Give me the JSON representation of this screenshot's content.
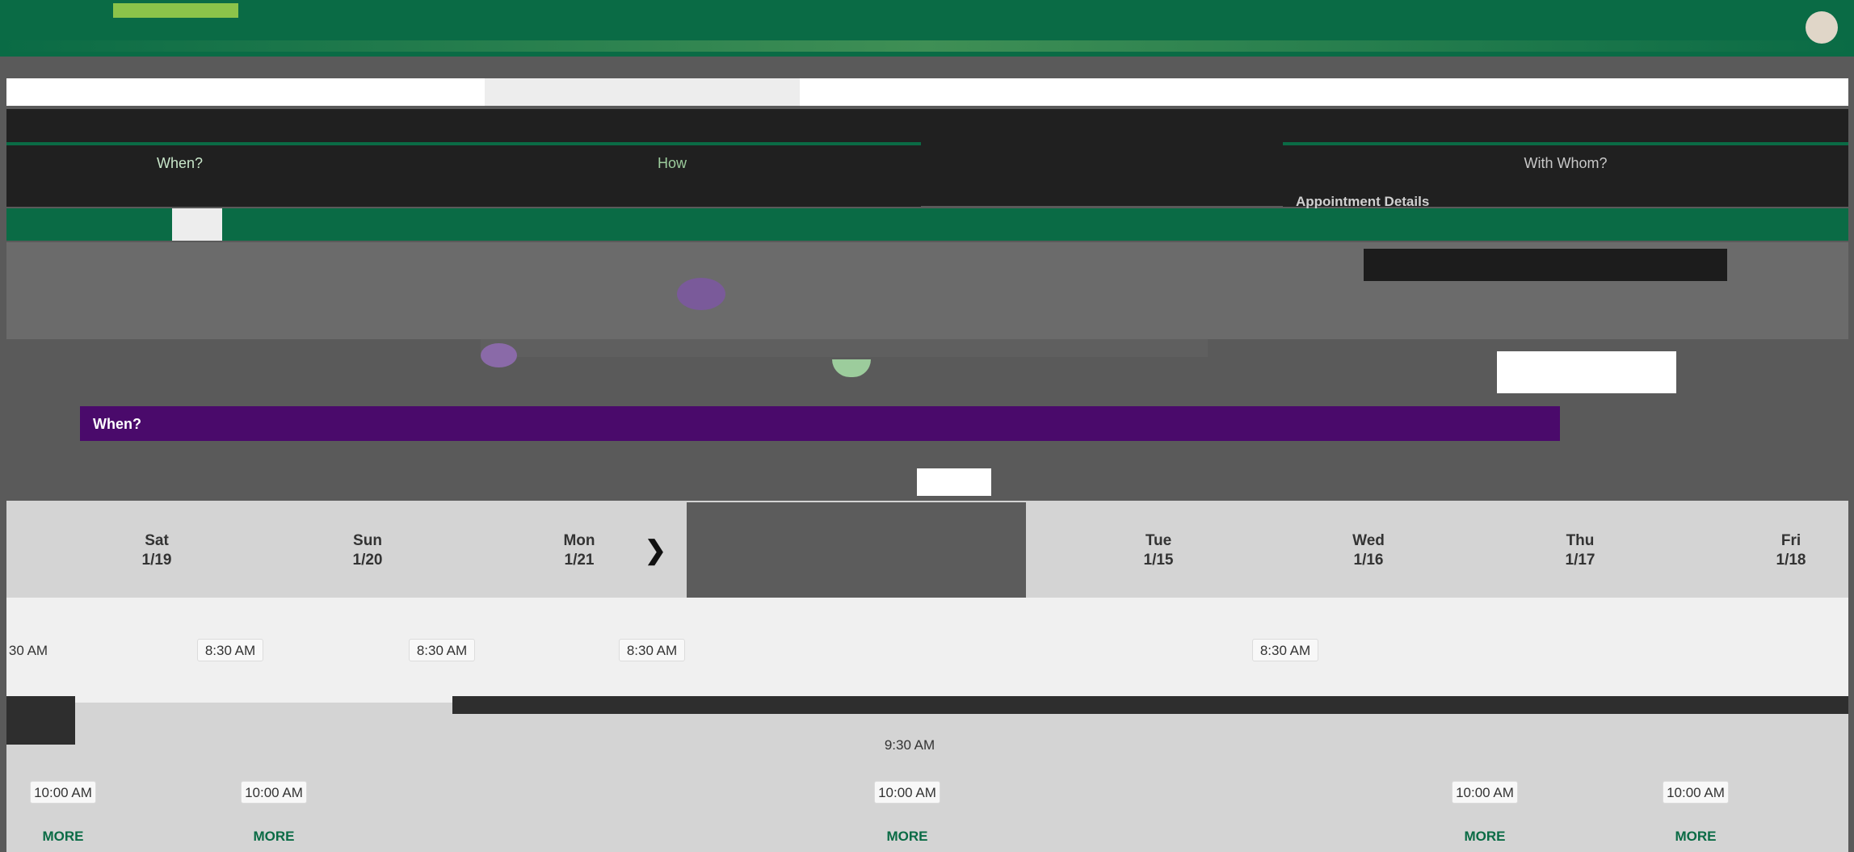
{
  "steps": {
    "when": "When?",
    "how": "How",
    "with_whom": "With Whom?"
  },
  "right_panel": {
    "details_title": "Appointment Details"
  },
  "when_section": {
    "title": "When?"
  },
  "days": [
    {
      "name": "Sat",
      "date": "1/19"
    },
    {
      "name": "Sun",
      "date": "1/20"
    },
    {
      "name": "Mon",
      "date": "1/21"
    },
    {
      "name": "Tue",
      "date": "1/15"
    },
    {
      "name": "Wed",
      "date": "1/16"
    },
    {
      "name": "Thu",
      "date": "1/17"
    },
    {
      "name": "Fri",
      "date": "1/18"
    }
  ],
  "slots": {
    "t830": "8:30 AM",
    "t830_partial": "30 AM",
    "t930": "9:30 AM",
    "t1000": "10:00 AM"
  },
  "more_label": "MORE",
  "icons": {
    "next": "chevron-right-icon"
  }
}
